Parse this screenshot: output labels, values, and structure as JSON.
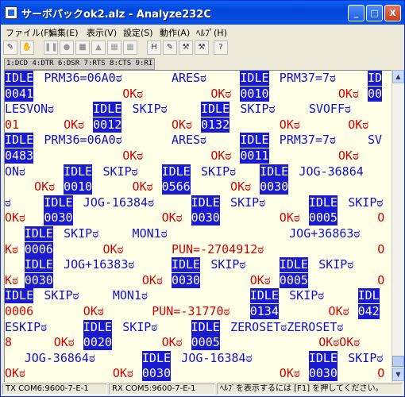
{
  "window": {
    "title": "サーボパックok2.alz - Analyze232C"
  },
  "title_buttons": {
    "minimize": "_",
    "maximize": "□",
    "close": "X"
  },
  "menu": [
    "ファイル(F)",
    "編集(E)",
    "表示(V)",
    "設定(S)",
    "動作(A)",
    "ﾍﾙﾌﾟ(H)"
  ],
  "toolbar": {
    "tools": [
      {
        "icon": "wrench-icon",
        "glyph": "✎"
      },
      {
        "icon": "hand-icon",
        "glyph": "✋"
      },
      {
        "icon": "pause-icon",
        "glyph": "❚❚"
      },
      {
        "icon": "record-icon",
        "glyph": "●"
      },
      {
        "icon": "stop-icon",
        "glyph": "■"
      },
      {
        "icon": "up-arrow-icon",
        "glyph": "▲"
      },
      {
        "icon": "grid-icon",
        "glyph": "▦"
      },
      {
        "icon": "grid-alt-icon",
        "glyph": "▦"
      },
      {
        "icon": "hex-icon",
        "glyph": "H"
      },
      {
        "icon": "tool-a-icon",
        "glyph": "✎"
      },
      {
        "icon": "tool-b-icon",
        "glyph": "⚒"
      },
      {
        "icon": "tool-c-icon",
        "glyph": "⚒"
      },
      {
        "icon": "help-pointer-icon",
        "glyph": "?"
      }
    ]
  },
  "signals": "1:DCD 4:DTR 6:DSR 7:RTS 8:CTS 9:RI",
  "log": [
    {
      "dir": "tx",
      "segs": [
        {
          "t": "IDLE",
          "hl": true,
          "c": 0
        },
        {
          "t": "PRM36=06A0ಠ",
          "c": 4
        },
        {
          "t": "ARESಠ",
          "c": 17
        },
        {
          "t": "IDLE",
          "hl": true,
          "c": 24
        },
        {
          "t": "PRM37=7ಠ",
          "c": 28
        },
        {
          "t": "ID",
          "hl": true,
          "c": 37
        }
      ]
    },
    {
      "dir": "rx",
      "segs": [
        {
          "t": "0041",
          "hl": true,
          "c": 0
        },
        {
          "t": "OKಠ",
          "c": 12
        },
        {
          "t": "OKಠ",
          "c": 21
        },
        {
          "t": "0010",
          "hl": true,
          "c": 24
        },
        {
          "t": "OKಠ",
          "c": 34
        },
        {
          "t": "00",
          "hl": true,
          "c": 37
        }
      ]
    },
    {
      "dir": "tx",
      "segs": [
        {
          "t": "LESVONಠ",
          "c": 0
        },
        {
          "t": "IDLE",
          "hl": true,
          "c": 9
        },
        {
          "t": "SKIPಠ",
          "c": 13
        },
        {
          "t": "IDLE",
          "hl": true,
          "c": 20
        },
        {
          "t": "SKIPಠ",
          "c": 24
        },
        {
          "t": "SVOFFಠ",
          "c": 31
        }
      ]
    },
    {
      "dir": "rx",
      "segs": [
        {
          "t": "01",
          "c": 0
        },
        {
          "t": "OKಠ",
          "c": 6
        },
        {
          "t": "0012",
          "hl": true,
          "c": 9
        },
        {
          "t": "OKಠ",
          "c": 17
        },
        {
          "t": "0132",
          "hl": true,
          "c": 20
        },
        {
          "t": "OKಠ",
          "c": 28
        },
        {
          "t": "OKಠ",
          "c": 35
        }
      ]
    },
    {
      "dir": "tx",
      "segs": [
        {
          "t": "IDLE",
          "hl": true,
          "c": 0
        },
        {
          "t": "PRM36=06A0ಠ",
          "c": 4
        },
        {
          "t": "ARESಠ",
          "c": 17
        },
        {
          "t": "IDLE",
          "hl": true,
          "c": 24
        },
        {
          "t": "PRM37=7ಠ",
          "c": 28
        },
        {
          "t": "SV",
          "c": 37
        }
      ]
    },
    {
      "dir": "rx",
      "segs": [
        {
          "t": "0483",
          "hl": true,
          "c": 0
        },
        {
          "t": "OKಠ",
          "c": 12
        },
        {
          "t": "OKಠ",
          "c": 21
        },
        {
          "t": "0011",
          "hl": true,
          "c": 24
        },
        {
          "t": "OKಠ",
          "c": 34
        }
      ]
    },
    {
      "dir": "tx",
      "segs": [
        {
          "t": "ONಠ",
          "c": 0
        },
        {
          "t": "IDLE",
          "hl": true,
          "c": 6
        },
        {
          "t": "SKIPಠ",
          "c": 10
        },
        {
          "t": "IDLE",
          "hl": true,
          "c": 16
        },
        {
          "t": "SKIPಠ",
          "c": 20
        },
        {
          "t": "IDLE",
          "hl": true,
          "c": 26
        },
        {
          "t": "JOG-36864",
          "c": 30
        }
      ]
    },
    {
      "dir": "rx",
      "segs": [
        {
          "t": "OKಠ",
          "c": 3
        },
        {
          "t": "0010",
          "hl": true,
          "c": 6
        },
        {
          "t": "OKಠ",
          "c": 13
        },
        {
          "t": "0566",
          "hl": true,
          "c": 16
        },
        {
          "t": "OKಠ",
          "c": 23
        },
        {
          "t": "0030",
          "hl": true,
          "c": 26
        }
      ]
    },
    {
      "dir": "tx",
      "segs": [
        {
          "t": "ಠ",
          "c": 0
        },
        {
          "t": "IDLE",
          "hl": true,
          "c": 4
        },
        {
          "t": "JOG-16384ಠ",
          "c": 8
        },
        {
          "t": "IDLE",
          "hl": true,
          "c": 19
        },
        {
          "t": "SKIPಠ",
          "c": 23
        },
        {
          "t": "IDLE",
          "hl": true,
          "c": 31
        },
        {
          "t": "SKIPಠ",
          "c": 35
        }
      ]
    },
    {
      "dir": "rx",
      "segs": [
        {
          "t": "OKಠ",
          "c": 0
        },
        {
          "t": "0030",
          "hl": true,
          "c": 4
        },
        {
          "t": "OKಠ",
          "c": 16
        },
        {
          "t": "0030",
          "hl": true,
          "c": 19
        },
        {
          "t": "OKಠ",
          "c": 28
        },
        {
          "t": "0005",
          "hl": true,
          "c": 31
        },
        {
          "t": "O",
          "c": 38
        }
      ]
    },
    {
      "dir": "tx",
      "segs": [
        {
          "t": "IDLE",
          "hl": true,
          "c": 2
        },
        {
          "t": "SKIPಠ",
          "c": 6
        },
        {
          "t": "MON1ಠ",
          "c": 13
        },
        {
          "t": "JOG+36863ಠ",
          "c": 29
        }
      ]
    },
    {
      "dir": "rx",
      "segs": [
        {
          "t": "Kಠ",
          "c": 0
        },
        {
          "t": "0006",
          "hl": true,
          "c": 2
        },
        {
          "t": "OKಠ",
          "c": 10
        },
        {
          "t": "PUN=-2704912ಠ",
          "c": 17
        },
        {
          "t": "O",
          "c": 38
        }
      ]
    },
    {
      "dir": "tx",
      "segs": [
        {
          "t": "IDLE",
          "hl": true,
          "c": 2
        },
        {
          "t": "JOG+16383ಠ",
          "c": 6
        },
        {
          "t": "IDLE",
          "hl": true,
          "c": 17
        },
        {
          "t": "SKIPಠ",
          "c": 21
        },
        {
          "t": "IDLE",
          "hl": true,
          "c": 28
        },
        {
          "t": "SKIPಠ",
          "c": 32
        }
      ]
    },
    {
      "dir": "rx",
      "segs": [
        {
          "t": "Kಠ",
          "c": 0
        },
        {
          "t": "0030",
          "hl": true,
          "c": 2
        },
        {
          "t": "OKಠ",
          "c": 14
        },
        {
          "t": "0030",
          "hl": true,
          "c": 17
        },
        {
          "t": "OKಠ",
          "c": 25
        },
        {
          "t": "0005",
          "hl": true,
          "c": 28
        },
        {
          "t": "O",
          "c": 38
        }
      ]
    },
    {
      "dir": "tx",
      "segs": [
        {
          "t": "IDLE",
          "hl": true,
          "c": 0
        },
        {
          "t": "SKIPಠ",
          "c": 4
        },
        {
          "t": "MON1ಠ",
          "c": 11
        },
        {
          "t": "IDLE",
          "hl": true,
          "c": 25
        },
        {
          "t": "SKIPಠ",
          "c": 29
        },
        {
          "t": "IDL",
          "hl": true,
          "c": 36
        }
      ]
    },
    {
      "dir": "rx",
      "segs": [
        {
          "t": "0006",
          "c": 0
        },
        {
          "t": "OKಠ",
          "c": 8
        },
        {
          "t": "PUN=-31770ಠ",
          "c": 15
        },
        {
          "t": "0134",
          "hl": true,
          "c": 25
        },
        {
          "t": "OKಠ",
          "c": 33
        },
        {
          "t": "042",
          "hl": true,
          "c": 36
        }
      ]
    },
    {
      "dir": "tx",
      "segs": [
        {
          "t": "ESKIPಠ",
          "c": 0
        },
        {
          "t": "IDLE",
          "hl": true,
          "c": 8
        },
        {
          "t": "SKIPಠ",
          "c": 12
        },
        {
          "t": "IDLE",
          "hl": true,
          "c": 19
        },
        {
          "t": "ZEROSETಠZEROSETಠ",
          "c": 23
        }
      ]
    },
    {
      "dir": "rx",
      "segs": [
        {
          "t": "8",
          "c": 0
        },
        {
          "t": "OKಠ",
          "c": 5
        },
        {
          "t": "0020",
          "hl": true,
          "c": 8
        },
        {
          "t": "OKಠ",
          "c": 16
        },
        {
          "t": "0005",
          "hl": true,
          "c": 19
        },
        {
          "t": "OKಠOKಠ",
          "c": 32
        }
      ]
    },
    {
      "dir": "tx",
      "segs": [
        {
          "t": "JOG-36864ಠ",
          "c": 2
        },
        {
          "t": "IDLE",
          "hl": true,
          "c": 14
        },
        {
          "t": "JOG-16384ಠ",
          "c": 18
        },
        {
          "t": "IDLE",
          "hl": true,
          "c": 31
        },
        {
          "t": "SKIPಠ",
          "c": 35
        }
      ]
    },
    {
      "dir": "rx",
      "segs": [
        {
          "t": "OKಠ",
          "c": 0
        },
        {
          "t": "OKಠ",
          "c": 11
        },
        {
          "t": "0030",
          "hl": true,
          "c": 14
        },
        {
          "t": "OKಠ",
          "c": 28
        },
        {
          "t": "0030",
          "hl": true,
          "c": 31
        },
        {
          "t": "O",
          "c": 38
        }
      ]
    }
  ],
  "status": {
    "tx": "TX COM6:9600-7-E-1",
    "rx": "RX COM5:9600-7-E-1",
    "help": "ﾍﾙﾌﾟを表示するには [F1] を押してください。"
  }
}
